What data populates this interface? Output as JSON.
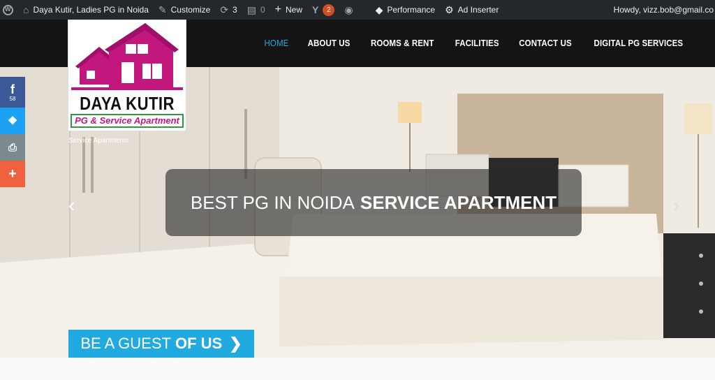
{
  "admin_bar": {
    "site_name": "Daya Kutir, Ladies PG in Noida",
    "customize": "Customize",
    "updates_count": "3",
    "comments_count": "0",
    "new_label": "New",
    "yoast_badge": "2",
    "performance": "Performance",
    "ad_inserter": "Ad Inserter",
    "howdy": "Howdy, vizz.bob@gmail.co"
  },
  "logo": {
    "title": "DAYA KUTIR",
    "subtitle": "PG & Service Apartment",
    "tagline": "Service Apartments"
  },
  "nav": {
    "items": [
      {
        "label": "HOME"
      },
      {
        "label": "ABOUT US"
      },
      {
        "label": "ROOMS & RENT"
      },
      {
        "label": "FACILITIES"
      },
      {
        "label": "CONTACT US"
      },
      {
        "label": "DIGITAL PG SERVICES"
      }
    ]
  },
  "hero": {
    "caption_light": "BEST PG IN NOIDA",
    "caption_bold": "SERVICE APARTMENT",
    "cta_light": "BE A GUEST",
    "cta_bold": "OF US"
  },
  "social": {
    "facebook_count": "58"
  },
  "colors": {
    "accent": "#29a8e0",
    "facebook": "#3b5998",
    "twitter": "#1da1f2",
    "print": "#7a8a8f",
    "share": "#f0623f",
    "brand": "#c2187d"
  }
}
